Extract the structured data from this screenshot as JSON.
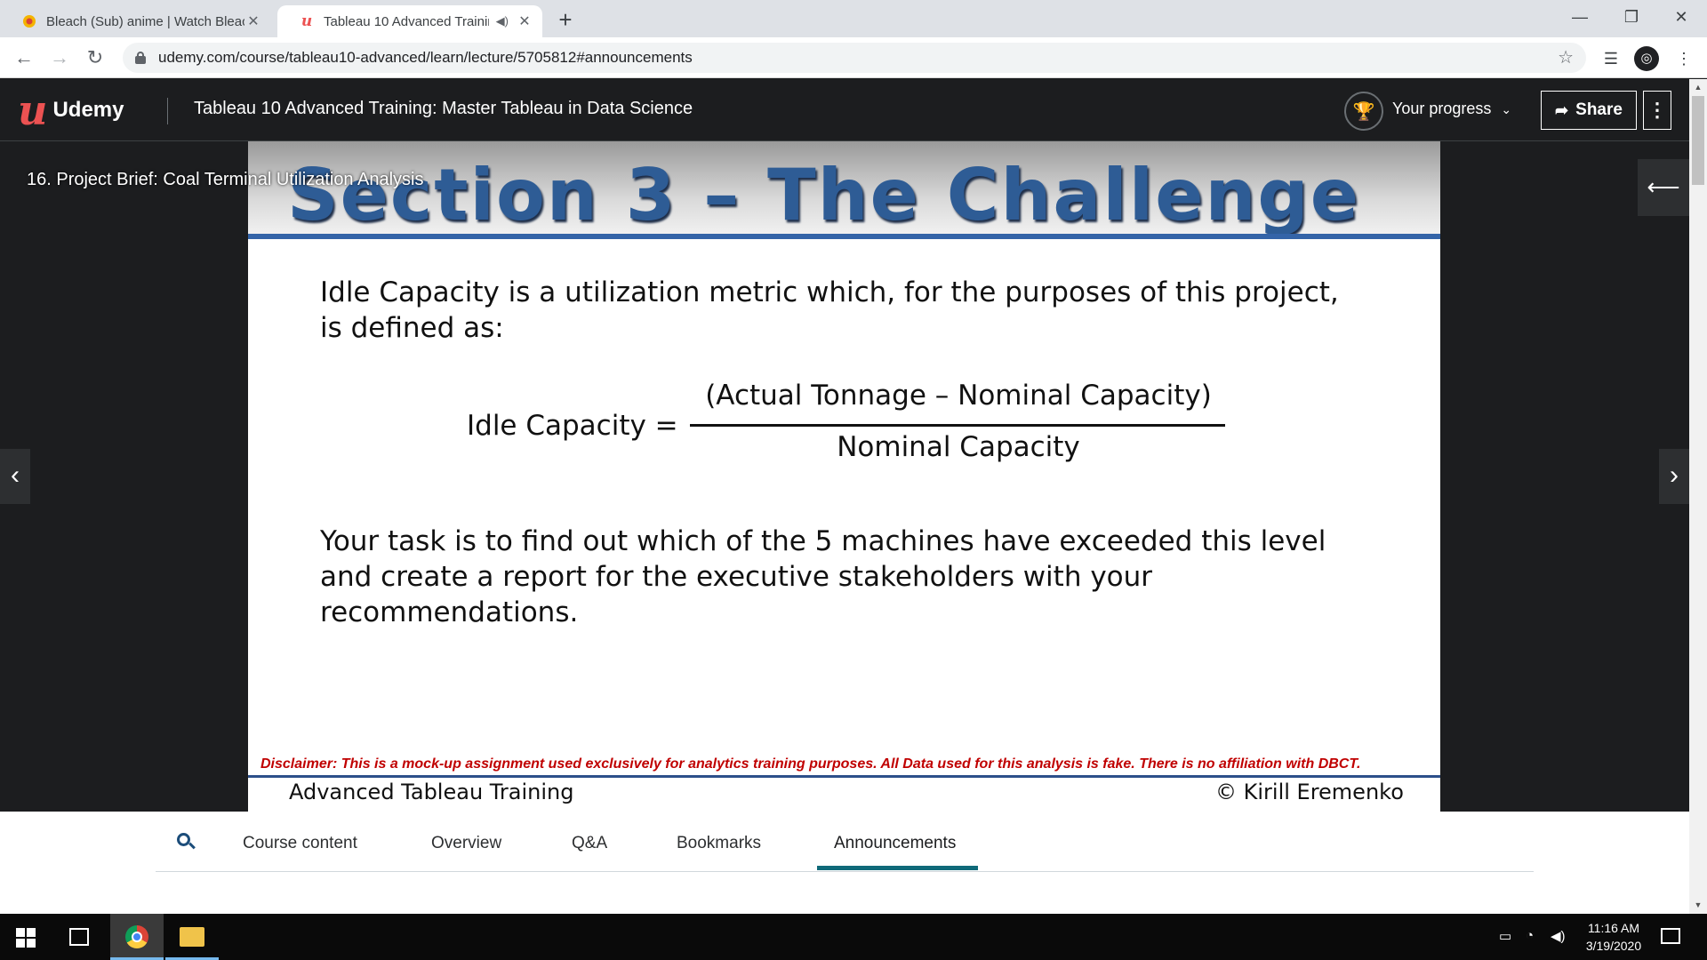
{
  "browser": {
    "tabs": [
      {
        "title": "Bleach (Sub) anime | Watch Bleac"
      },
      {
        "title": "Tableau 10 Advanced Trainin"
      }
    ],
    "url": "udemy.com/course/tableau10-advanced/learn/lecture/5705812#announcements"
  },
  "header": {
    "logo_text": "Udemy",
    "course_title": "Tableau 10 Advanced Training: Master Tableau in Data Science",
    "progress_label": "Your progress",
    "share_label": "Share"
  },
  "player": {
    "lecture_title": "16. Project Brief: Coal Terminal Utilization Analysis"
  },
  "slide": {
    "heading": "Section 3 – The Challenge",
    "paragraph1": "Idle Capacity is a utilization metric which, for the purposes of this project, is defined as:",
    "formula_label": "Idle Capacity =",
    "formula_numerator": "(Actual Tonnage – Nominal Capacity)",
    "formula_denominator": "Nominal Capacity",
    "paragraph2": "Your task is to find out which of the 5 machines have exceeded this level and create a report for the executive stakeholders with your recommendations.",
    "disclaimer": "Disclaimer: This is a mock-up assignment used exclusively for analytics training purposes. All Data used for this analysis is fake. There is no affiliation with DBCT.",
    "footer_left": "Advanced Tableau Training",
    "footer_right": "© Kirill Eremenko"
  },
  "course_tabs": {
    "items": [
      "Course content",
      "Overview",
      "Q&A",
      "Bookmarks",
      "Announcements"
    ],
    "active": "Announcements"
  },
  "taskbar": {
    "time": "11:16 AM",
    "date": "3/19/2020"
  },
  "colors": {
    "udemy_red": "#ec5252",
    "slide_heading": "#2e5c95",
    "disclaimer_red": "#c00000",
    "active_tab_underline": "#0f6a79"
  }
}
